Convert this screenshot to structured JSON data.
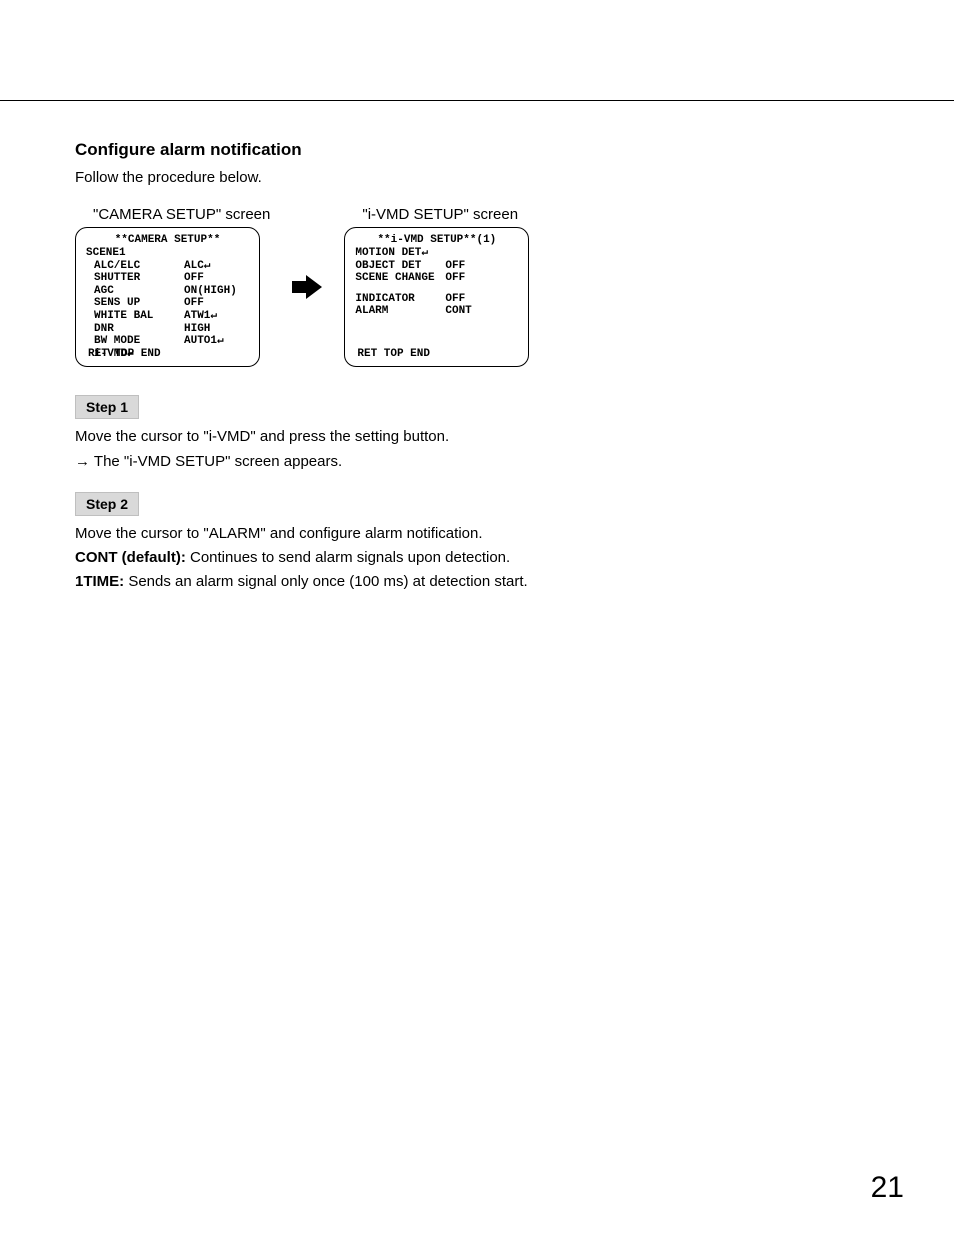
{
  "heading": "Configure alarm notification",
  "intro": "Follow the procedure below.",
  "screen1": {
    "label": "\"CAMERA SETUP\" screen",
    "title": "**CAMERA SETUP**",
    "scene": "SCENE1",
    "rows": [
      {
        "l": "ALC/ELC",
        "r": "ALC↵"
      },
      {
        "l": "SHUTTER",
        "r": "OFF"
      },
      {
        "l": "AGC",
        "r": "ON(HIGH)"
      },
      {
        "l": "SENS UP",
        "r": "OFF"
      },
      {
        "l": "WHITE BAL",
        "r": "ATW1↵"
      },
      {
        "l": "DNR",
        "r": "HIGH"
      },
      {
        "l": "BW MODE",
        "r": "AUTO1↵"
      },
      {
        "l": "i-VMD↵",
        "r": ""
      }
    ],
    "footer": "RET TOP END"
  },
  "screen2": {
    "label": "\"i-VMD SETUP\" screen",
    "title": "**i-VMD SETUP**(1)",
    "rows_a": [
      {
        "l": "MOTION DET↵",
        "r": ""
      },
      {
        "l": "OBJECT DET",
        "r": "OFF"
      },
      {
        "l": "SCENE CHANGE",
        "r": "OFF"
      }
    ],
    "rows_b": [
      {
        "l": "INDICATOR",
        "r": "OFF"
      },
      {
        "l": "ALARM",
        "r": "CONT"
      }
    ],
    "footer": "RET TOP END"
  },
  "step1": {
    "label": "Step 1",
    "text": "Move the cursor to \"i-VMD\" and press the setting button.",
    "arrow": "→",
    "result": "The \"i-VMD SETUP\" screen appears."
  },
  "step2": {
    "label": "Step 2",
    "line1": "Move the cursor to \"ALARM\" and configure alarm notification.",
    "cont_b": "CONT (default):",
    "cont_t": " Continues to send alarm signals upon detection.",
    "one_b": "1TIME:",
    "one_t": " Sends an alarm signal only once (100 ms) at detection start."
  },
  "page": "21"
}
